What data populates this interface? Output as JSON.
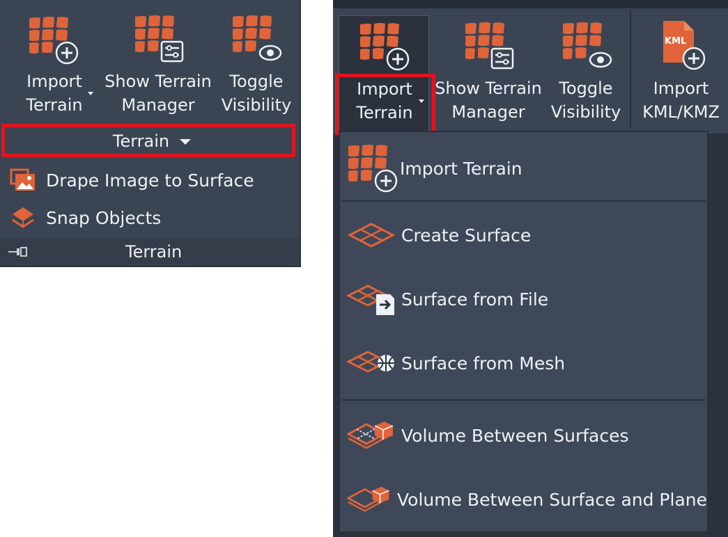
{
  "left_panel": {
    "buttons": [
      {
        "line1": "Import",
        "line2": "Terrain",
        "icon": "terrain-grid-plus-icon"
      },
      {
        "line1": "Show Terrain",
        "line2": "Manager",
        "icon": "terrain-grid-settings-icon"
      },
      {
        "line1": "Toggle",
        "line2": "Visibility",
        "icon": "terrain-grid-eye-icon"
      }
    ],
    "dropdown_label": "Terrain",
    "items": [
      {
        "label": "Drape Image to Surface",
        "icon": "drape-image-icon"
      },
      {
        "label": "Snap Objects",
        "icon": "snap-objects-icon"
      }
    ],
    "footer_label": "Terrain",
    "footer_icon": "pin-panel-icon"
  },
  "right_panel": {
    "buttons": [
      {
        "line1": "Import",
        "line2": "Terrain",
        "icon": "terrain-grid-plus-icon"
      },
      {
        "line1": "Show Terrain",
        "line2": "Manager",
        "icon": "terrain-grid-settings-icon"
      },
      {
        "line1": "Toggle",
        "line2": "Visibility",
        "icon": "terrain-grid-eye-icon"
      },
      {
        "line1": "Import",
        "line2": "KML/KMZ",
        "icon": "kml-file-plus-icon",
        "badge": "KML"
      }
    ],
    "menu_items": [
      {
        "label": "Import Terrain",
        "icon": "terrain-grid-plus-icon"
      },
      {
        "label": "Create Surface",
        "icon": "surface-icon"
      },
      {
        "label": "Surface from File",
        "icon": "surface-file-icon"
      },
      {
        "label": "Surface from Mesh",
        "icon": "surface-mesh-icon"
      },
      {
        "label": "Volume Between Surfaces",
        "icon": "volume-surfaces-icon"
      },
      {
        "label": "Volume Between Surface and Plane",
        "icon": "volume-plane-icon"
      }
    ]
  },
  "colors": {
    "panel_bg": "#3b4453",
    "dark_bg": "#2b323d",
    "accent_orange": "#e0643a",
    "highlight_red": "#e0141d"
  }
}
